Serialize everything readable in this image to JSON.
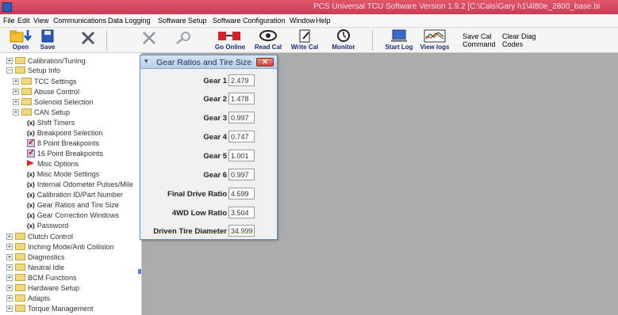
{
  "window": {
    "title": "PCS Universal TCU Software Version 1.9.2 [C:\\Cals\\Gary h1\\4l80e_2800_base.bi"
  },
  "menu": [
    "File",
    "Edit",
    "View",
    "Communications",
    "Data Logging",
    "Software Setup",
    "Software Configuration",
    "Window",
    "Help"
  ],
  "toolbar": {
    "open": "Open",
    "save": "Save",
    "go_online": "Go Online",
    "read_cal": "Read Cal",
    "write_cal": "Write Cal",
    "monitor": "Monitor",
    "start_log": "Start Log",
    "view_logs": "View logs",
    "save_cal_line1": "Save Cal",
    "save_cal_line2": "Command",
    "clear_diag_line1": "Clear Diag",
    "clear_diag_line2": "Codes"
  },
  "tree": {
    "calibration_tuning": "Calibration/Tuning",
    "setup_info": "Setup Info",
    "tcc_settings": "TCC Settings",
    "abuse_control": "Abuse Control",
    "solenoid_selection": "Solenoid Selection",
    "can_setup": "CAN Setup",
    "shift_timers": "Shift Timers",
    "breakpoint_selection": "Breakpoint Selection",
    "bp8": "8 Point Breakpoints",
    "bp16": "16 Point Breakpoints",
    "misc_options": "Misc Options",
    "misc_mode_settings": "Misc Mode Settings",
    "internal_odometer": "Internal Odometer Pulses/Mile",
    "calibration_id": "Calibration ID/Part Number",
    "gear_ratios": "Gear Ratios and Tire Size",
    "gear_correction": "Gear Correction Windows",
    "password": "Password",
    "clutch_control": "Clutch Control",
    "inching_mode": "Inching Mode/Anti Collision",
    "diagnostics": "Diagnostics",
    "neutral_idle": "Neutral Idle",
    "bcm_functions": "BCM Functions",
    "hardware_setup": "Hardware Setup",
    "adapts": "Adapts",
    "torque_management": "Torque Management",
    "marker_x": "(x)",
    "expand": "+",
    "collapse": "−"
  },
  "dialog": {
    "title": "Gear Ratios and Tire Size",
    "close": "✕",
    "fields": [
      {
        "label": "Gear 1",
        "value": "2.479"
      },
      {
        "label": "Gear 2",
        "value": "1.478"
      },
      {
        "label": "Gear 3",
        "value": "0.997"
      },
      {
        "label": "Gear 4",
        "value": "0.747"
      },
      {
        "label": "Gear 5",
        "value": "1.001"
      },
      {
        "label": "Gear 6",
        "value": "0.997"
      },
      {
        "label": "Final Drive Ratio",
        "value": "4.599"
      },
      {
        "label": "4WD Low Ratio",
        "value": "3.504"
      },
      {
        "label": "Driven Tire Diameter",
        "value": "34.999"
      }
    ]
  },
  "colors": {
    "titlebar": "#d44a60",
    "mdi_background": "#ababab",
    "accent": "#1a2a7a"
  }
}
